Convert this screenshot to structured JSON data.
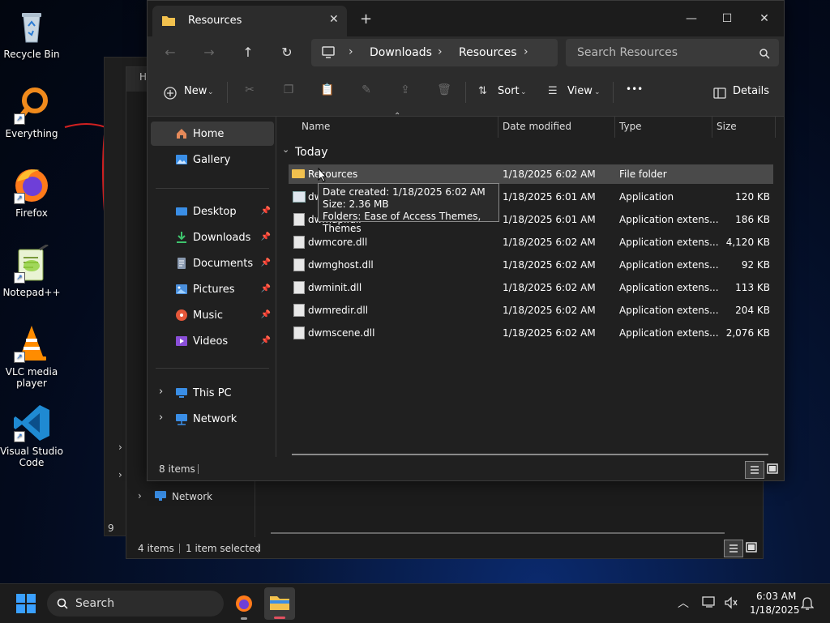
{
  "desktop": {
    "icons": [
      {
        "label": "Recycle Bin"
      },
      {
        "label": "Everything"
      },
      {
        "label": "Firefox"
      },
      {
        "label": "Notepad++"
      },
      {
        "label": "VLC media player"
      },
      {
        "label": "Visual Studio Code"
      }
    ]
  },
  "back_window": {
    "sidebar_network": "Network",
    "status_count": "4 items",
    "status_selected": "1 item selected",
    "partial_title": "H",
    "partial_status": "9"
  },
  "explorer": {
    "tab_title": "Resources",
    "tab_close": "✕",
    "new_tab": "+",
    "controls": {
      "minimize": "—",
      "maximize": "☐",
      "close": "✕"
    },
    "breadcrumb": [
      "Downloads",
      "Resources"
    ],
    "search_placeholder": "Search Resources",
    "toolbar": {
      "new": "New",
      "sort": "Sort",
      "view": "View",
      "more": "•••",
      "details": "Details"
    },
    "sidebar": {
      "home": "Home",
      "gallery": "Gallery",
      "quick": [
        "Desktop",
        "Downloads",
        "Documents",
        "Pictures",
        "Music",
        "Videos"
      ],
      "this_pc": "This PC",
      "network": "Network"
    },
    "columns": {
      "name": "Name",
      "date": "Date modified",
      "type": "Type",
      "size": "Size"
    },
    "group": "Today",
    "files": [
      {
        "name": "Resources",
        "date": "1/18/2025 6:02 AM",
        "type": "File folder",
        "size": "",
        "icon": "folder-icon"
      },
      {
        "name": "dwm.exe",
        "date": "1/18/2025 6:01 AM",
        "type": "Application",
        "size": "120 KB",
        "icon": "app-icon"
      },
      {
        "name": "dwmapi.dll",
        "date": "1/18/2025 6:01 AM",
        "type": "Application extens...",
        "size": "186 KB",
        "icon": "file-icon"
      },
      {
        "name": "dwmcore.dll",
        "date": "1/18/2025 6:02 AM",
        "type": "Application extens...",
        "size": "4,120 KB",
        "icon": "file-icon"
      },
      {
        "name": "dwmghost.dll",
        "date": "1/18/2025 6:02 AM",
        "type": "Application extens...",
        "size": "92 KB",
        "icon": "file-icon"
      },
      {
        "name": "dwminit.dll",
        "date": "1/18/2025 6:02 AM",
        "type": "Application extens...",
        "size": "113 KB",
        "icon": "file-icon"
      },
      {
        "name": "dwmredir.dll",
        "date": "1/18/2025 6:02 AM",
        "type": "Application extens...",
        "size": "204 KB",
        "icon": "file-icon"
      },
      {
        "name": "dwmscene.dll",
        "date": "1/18/2025 6:02 AM",
        "type": "Application extens...",
        "size": "2,076 KB",
        "icon": "file-icon"
      }
    ],
    "tooltip": {
      "created": "Date created: 1/18/2025 6:02 AM",
      "size": "Size: 2.36 MB",
      "folders": "Folders: Ease of Access Themes, Themes"
    },
    "status_count": "8 items"
  },
  "taskbar": {
    "search": "Search",
    "time": "6:03 AM",
    "date": "1/18/2025"
  },
  "colors": {
    "accent": "#0078d4",
    "folder": "#f2c14e",
    "selection": "#4a4a4a"
  }
}
